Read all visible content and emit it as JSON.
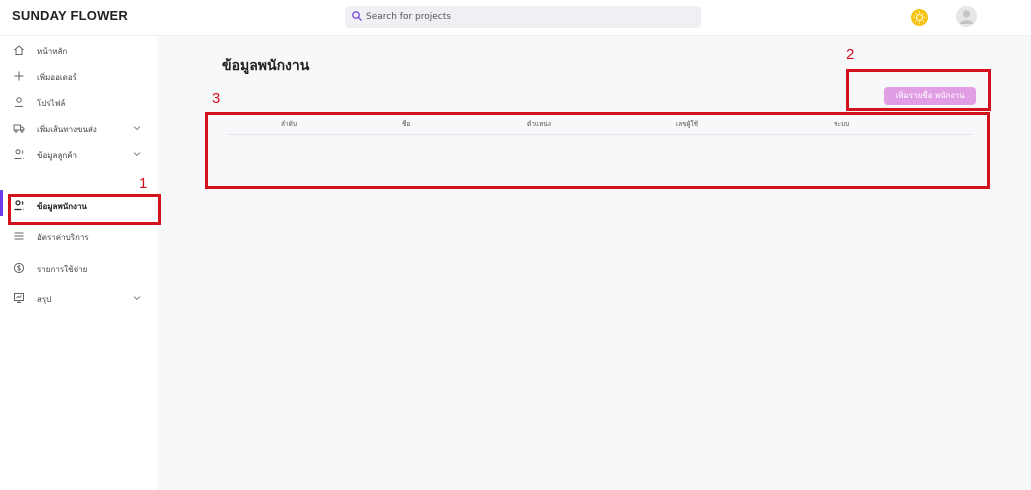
{
  "app": {
    "brand": "SUNDAY FLOWER"
  },
  "search": {
    "placeholder": "Search for projects"
  },
  "sidebar": {
    "items": [
      {
        "label": "หน้าหลัก",
        "icon": "home-icon"
      },
      {
        "label": "เพิ่มออเดอร์",
        "icon": "plus-icon"
      },
      {
        "label": "โปรไฟล์",
        "icon": "user-icon"
      },
      {
        "label": "เพิ่มเส้นทางขนส่ง",
        "icon": "truck-icon",
        "expandable": true
      },
      {
        "label": "ข้อมูลลูกค้า",
        "icon": "users-icon",
        "expandable": true
      },
      {
        "label": "ข้อมูลพนักงาน",
        "icon": "users-icon",
        "active": true
      },
      {
        "label": "อัตราค่าบริการ",
        "icon": "list-icon"
      },
      {
        "label": "รายการใช้จ่าย",
        "icon": "dollar-icon"
      },
      {
        "label": "สรุป",
        "icon": "report-icon",
        "expandable": true
      }
    ]
  },
  "main": {
    "title": "ข้อมูลพนักงาน",
    "add_button": "เพิ่มรายชื่อ พนักงาน",
    "table": {
      "columns": [
        "ลำดับ",
        "ชื่อ",
        "ตำแหน่ง",
        "เลขผู้ใช้",
        "ระบบ"
      ],
      "rows": []
    }
  },
  "annotations": [
    "1",
    "2",
    "3"
  ],
  "colors": {
    "accent": "#6a3de8",
    "button": "#e19ee5",
    "annotation": "#d2121d",
    "toggle_knob": "#f6c40f"
  }
}
